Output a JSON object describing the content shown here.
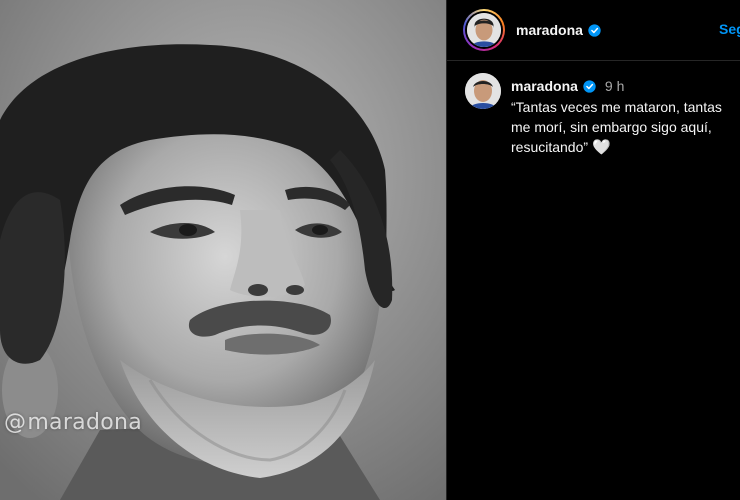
{
  "post": {
    "watermark_text": "maradona",
    "header": {
      "username": "maradona",
      "verified": true,
      "action_label": "Seguir"
    },
    "caption": {
      "username": "maradona",
      "verified": true,
      "time": "9 h",
      "text": "“Tantas veces me mataron, tantas me morí, sin embargo sigo aquí, resucitando”",
      "emoji": "🤍"
    }
  },
  "colors": {
    "background": "#000000",
    "link_blue": "#0095f6",
    "verified_blue": "#0095f6",
    "muted_text": "#a8a8a8"
  },
  "icons": {
    "verified": "verified-badge-icon",
    "heart": "white-heart-icon"
  }
}
